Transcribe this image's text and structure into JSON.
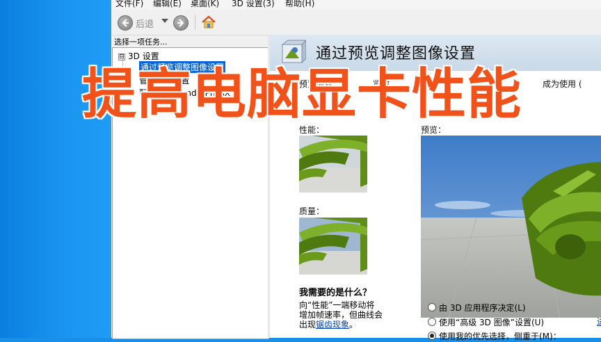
{
  "menubar": {
    "items": [
      "文件(F)",
      "编辑(E)",
      "桌面(K)",
      "3D 设置(3)",
      "帮助(H)"
    ]
  },
  "toolbar": {
    "back_label": "后退",
    "back_icon": "back-arrow-icon",
    "forward_icon": "forward-arrow-icon",
    "home_icon": "home-icon"
  },
  "sidebar": {
    "prompt": "选择一项任务...",
    "root": {
      "toggle": "⊟",
      "label": "3D 设置"
    },
    "items": [
      {
        "label": "通过预览调整图像设置",
        "selected": true
      },
      {
        "label": "管理 3D 设置",
        "selected": false
      },
      {
        "label": "配置 Surround、PhysX",
        "selected": false
      }
    ]
  },
  "main": {
    "title": "通过预览调整图像设置",
    "description": {
      "left": "预览你对",
      "middle": "览你",
      "right": "成为使用 ("
    },
    "performance_label": "性能：",
    "quality_label": "质量：",
    "preview_label": "预览：",
    "faq_title": "我需要的是什么？",
    "faq_lines": [
      "向“性能”一端移动将",
      "增加帧速率，但曲线会"
    ],
    "faq_last_prefix": "出现",
    "faq_link": "锯齿现象",
    "faq_last_suffix": "。",
    "options": [
      {
        "label": "由 3D 应用程序决定(L)",
        "checked": false
      },
      {
        "label": "使用“高级 3D 图像”设置(U)",
        "checked": false
      },
      {
        "label": "使用我的优先选择，侧重于(M)：",
        "checked": true
      }
    ],
    "edge_link": "进"
  },
  "overlay": {
    "headline": "提高电脑显卡性能",
    "color": "#f1521a"
  },
  "colors": {
    "desktop": "#1a8fe8",
    "selection": "#0a64d6",
    "nvidia_green": "#6a9a1a"
  }
}
